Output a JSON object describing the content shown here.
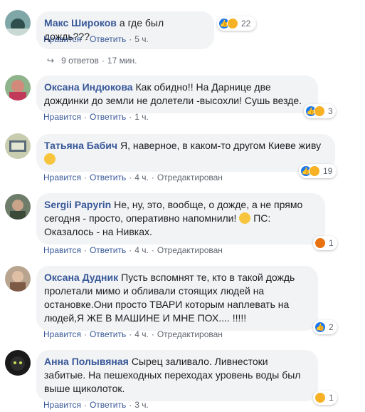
{
  "comments": [
    {
      "author": "Макс Широков",
      "text": "а где был дождь???",
      "reaction_count": "22",
      "reaction_icons": [
        "like-icon",
        "haha-icon"
      ],
      "like": "Нравится",
      "reply": "Ответить",
      "time": "5 ч.",
      "replies_label": "9 ответов",
      "replies_time": "17 мин."
    },
    {
      "author": "Оксана Индюкова",
      "text": "Как обидно!! На Дарнице две дождинки до земли не долетели -высохли! Сушь везде.",
      "reaction_count": "3",
      "reaction_icons": [
        "like-icon",
        "haha-icon"
      ],
      "like": "Нравится",
      "reply": "Ответить",
      "time": "1 ч."
    },
    {
      "author": "Татьяна Бабич",
      "text": "Я, наверное, в каком-то другом Киеве живу",
      "reaction_count": "19",
      "reaction_icons": [
        "like-icon",
        "haha-icon"
      ],
      "like": "Нравится",
      "reply": "Ответить",
      "time": "4 ч.",
      "edited": "Отредактирован"
    },
    {
      "author": "Sergii Papyrin",
      "text": "Не, ну, это, вообще, о дожде, а не прямо сегодня - просто, оперативно напомнили!",
      "text2": "ПС: Оказалось - на Нивках.",
      "reaction_count": "1",
      "reaction_icons": [
        "angry-icon"
      ],
      "like": "Нравится",
      "reply": "Ответить",
      "time": "4 ч.",
      "edited": "Отредактирован"
    },
    {
      "author": "Оксана Дудник",
      "text": "Пусть вспомнят те, кто в такой дождь пролетали мимо и обливали стоящих людей на остановке.Они просто ТВАРИ которым наплевать на людей,Я ЖЕ В МАШИНЕ И МНЕ ПОХ.... !!!!!",
      "reaction_count": "2",
      "reaction_icons": [
        "like-icon"
      ],
      "like": "Нравится",
      "reply": "Ответить",
      "time": "4 ч.",
      "edited": "Отредактирован"
    },
    {
      "author": "Анна Полывяная",
      "text": "Сырец заливало. Ливнестоки забитые. На пешеходных переходах уровень воды был выше щиколоток.",
      "reaction_count": "1",
      "reaction_icons": [
        "wow-icon"
      ],
      "like": "Нравится",
      "reply": "Ответить",
      "time": "3 ч."
    }
  ],
  "colors": {
    "link": "#385898",
    "bubble": "#f2f3f5",
    "meta": "#606770",
    "like": "#1877f2"
  }
}
